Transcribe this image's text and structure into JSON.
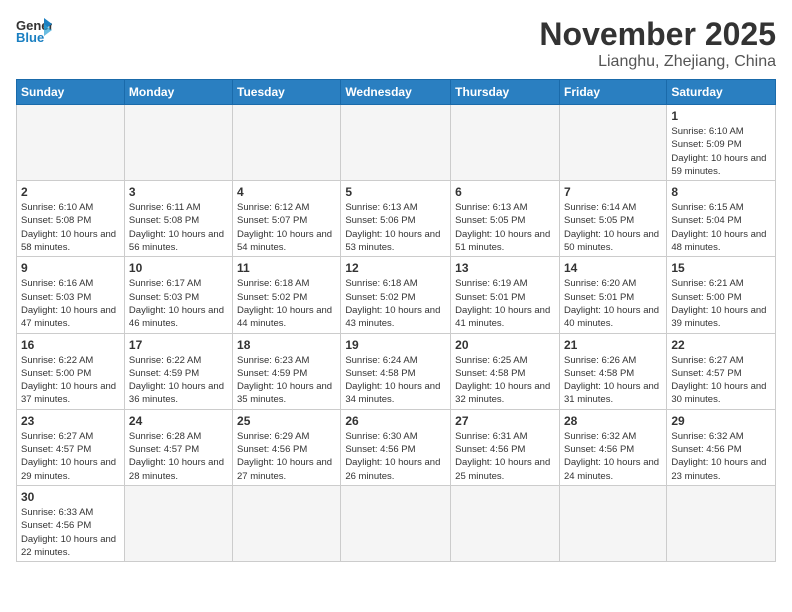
{
  "header": {
    "logo_general": "General",
    "logo_blue": "Blue",
    "month_year": "November 2025",
    "location": "Lianghu, Zhejiang, China"
  },
  "days_of_week": [
    "Sunday",
    "Monday",
    "Tuesday",
    "Wednesday",
    "Thursday",
    "Friday",
    "Saturday"
  ],
  "weeks": [
    [
      {
        "day": "",
        "info": ""
      },
      {
        "day": "",
        "info": ""
      },
      {
        "day": "",
        "info": ""
      },
      {
        "day": "",
        "info": ""
      },
      {
        "day": "",
        "info": ""
      },
      {
        "day": "",
        "info": ""
      },
      {
        "day": "1",
        "info": "Sunrise: 6:10 AM\nSunset: 5:09 PM\nDaylight: 10 hours and 59 minutes."
      }
    ],
    [
      {
        "day": "2",
        "info": "Sunrise: 6:10 AM\nSunset: 5:08 PM\nDaylight: 10 hours and 58 minutes."
      },
      {
        "day": "3",
        "info": "Sunrise: 6:11 AM\nSunset: 5:08 PM\nDaylight: 10 hours and 56 minutes."
      },
      {
        "day": "4",
        "info": "Sunrise: 6:12 AM\nSunset: 5:07 PM\nDaylight: 10 hours and 54 minutes."
      },
      {
        "day": "5",
        "info": "Sunrise: 6:13 AM\nSunset: 5:06 PM\nDaylight: 10 hours and 53 minutes."
      },
      {
        "day": "6",
        "info": "Sunrise: 6:13 AM\nSunset: 5:05 PM\nDaylight: 10 hours and 51 minutes."
      },
      {
        "day": "7",
        "info": "Sunrise: 6:14 AM\nSunset: 5:05 PM\nDaylight: 10 hours and 50 minutes."
      },
      {
        "day": "8",
        "info": "Sunrise: 6:15 AM\nSunset: 5:04 PM\nDaylight: 10 hours and 48 minutes."
      }
    ],
    [
      {
        "day": "9",
        "info": "Sunrise: 6:16 AM\nSunset: 5:03 PM\nDaylight: 10 hours and 47 minutes."
      },
      {
        "day": "10",
        "info": "Sunrise: 6:17 AM\nSunset: 5:03 PM\nDaylight: 10 hours and 46 minutes."
      },
      {
        "day": "11",
        "info": "Sunrise: 6:18 AM\nSunset: 5:02 PM\nDaylight: 10 hours and 44 minutes."
      },
      {
        "day": "12",
        "info": "Sunrise: 6:18 AM\nSunset: 5:02 PM\nDaylight: 10 hours and 43 minutes."
      },
      {
        "day": "13",
        "info": "Sunrise: 6:19 AM\nSunset: 5:01 PM\nDaylight: 10 hours and 41 minutes."
      },
      {
        "day": "14",
        "info": "Sunrise: 6:20 AM\nSunset: 5:01 PM\nDaylight: 10 hours and 40 minutes."
      },
      {
        "day": "15",
        "info": "Sunrise: 6:21 AM\nSunset: 5:00 PM\nDaylight: 10 hours and 39 minutes."
      }
    ],
    [
      {
        "day": "16",
        "info": "Sunrise: 6:22 AM\nSunset: 5:00 PM\nDaylight: 10 hours and 37 minutes."
      },
      {
        "day": "17",
        "info": "Sunrise: 6:22 AM\nSunset: 4:59 PM\nDaylight: 10 hours and 36 minutes."
      },
      {
        "day": "18",
        "info": "Sunrise: 6:23 AM\nSunset: 4:59 PM\nDaylight: 10 hours and 35 minutes."
      },
      {
        "day": "19",
        "info": "Sunrise: 6:24 AM\nSunset: 4:58 PM\nDaylight: 10 hours and 34 minutes."
      },
      {
        "day": "20",
        "info": "Sunrise: 6:25 AM\nSunset: 4:58 PM\nDaylight: 10 hours and 32 minutes."
      },
      {
        "day": "21",
        "info": "Sunrise: 6:26 AM\nSunset: 4:58 PM\nDaylight: 10 hours and 31 minutes."
      },
      {
        "day": "22",
        "info": "Sunrise: 6:27 AM\nSunset: 4:57 PM\nDaylight: 10 hours and 30 minutes."
      }
    ],
    [
      {
        "day": "23",
        "info": "Sunrise: 6:27 AM\nSunset: 4:57 PM\nDaylight: 10 hours and 29 minutes."
      },
      {
        "day": "24",
        "info": "Sunrise: 6:28 AM\nSunset: 4:57 PM\nDaylight: 10 hours and 28 minutes."
      },
      {
        "day": "25",
        "info": "Sunrise: 6:29 AM\nSunset: 4:56 PM\nDaylight: 10 hours and 27 minutes."
      },
      {
        "day": "26",
        "info": "Sunrise: 6:30 AM\nSunset: 4:56 PM\nDaylight: 10 hours and 26 minutes."
      },
      {
        "day": "27",
        "info": "Sunrise: 6:31 AM\nSunset: 4:56 PM\nDaylight: 10 hours and 25 minutes."
      },
      {
        "day": "28",
        "info": "Sunrise: 6:32 AM\nSunset: 4:56 PM\nDaylight: 10 hours and 24 minutes."
      },
      {
        "day": "29",
        "info": "Sunrise: 6:32 AM\nSunset: 4:56 PM\nDaylight: 10 hours and 23 minutes."
      }
    ],
    [
      {
        "day": "30",
        "info": "Sunrise: 6:33 AM\nSunset: 4:56 PM\nDaylight: 10 hours and 22 minutes."
      },
      {
        "day": "",
        "info": ""
      },
      {
        "day": "",
        "info": ""
      },
      {
        "day": "",
        "info": ""
      },
      {
        "day": "",
        "info": ""
      },
      {
        "day": "",
        "info": ""
      },
      {
        "day": "",
        "info": ""
      }
    ]
  ]
}
